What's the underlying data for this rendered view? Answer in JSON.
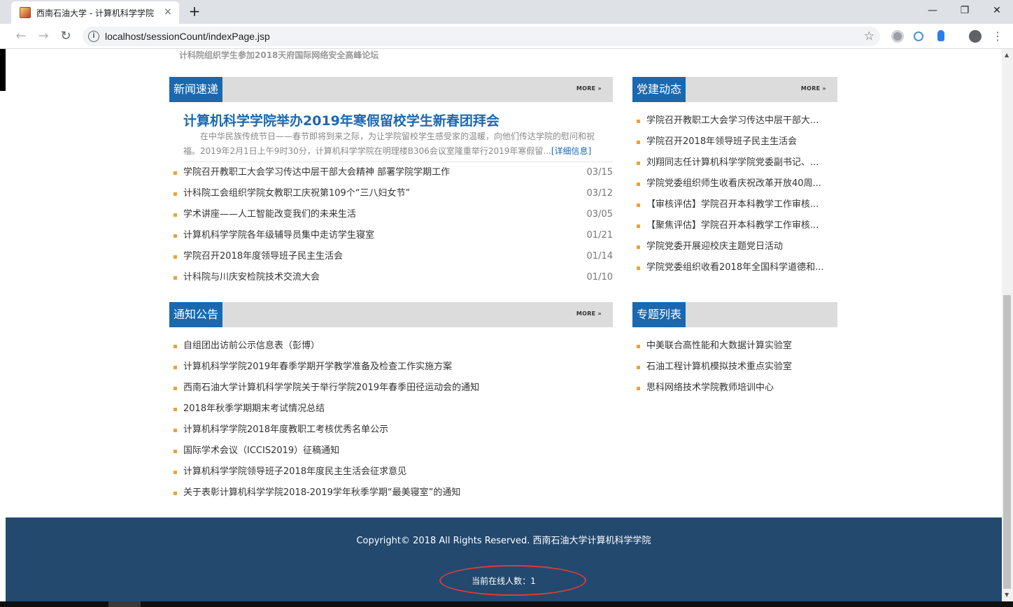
{
  "browser": {
    "tab_title": "西南石油大学 - 计算机科学学院",
    "url": "localhost/sessionCount/indexPage.jsp",
    "icons": {
      "tab_close": "×",
      "new_tab": "+",
      "minimize": "—",
      "restore": "❐",
      "close": "✕",
      "back": "←",
      "forward": "→",
      "reload": "↻",
      "info": "i",
      "star": "☆",
      "menu": "⋮"
    }
  },
  "page": {
    "top_news": "计科院组织学生参加2018天府国际网络安全高峰论坛",
    "news": {
      "title": "新闻速递",
      "more": "MORE »",
      "headline": "计算机科学学院举办2019年寒假留校学生新春团拜会",
      "summary": "在中华民族传统节日——春节即将到来之际，为让学院留校学生感受家的温暖，向他们传达学院的慰问和祝福。2019年2月1日上午9时30分，计算机科学学院在明理楼B306会议室隆重举行2019年寒假留...",
      "detail_link": "[详细信息]",
      "items": [
        {
          "text": "学院召开教职工大会学习传达中层干部大会精神 部署学院学期工作",
          "date": "03/15"
        },
        {
          "text": "计科院工会组织学院女教职工庆祝第109个“三八妇女节”",
          "date": "03/12"
        },
        {
          "text": "学术讲座——人工智能改变我们的未来生活",
          "date": "03/05"
        },
        {
          "text": "计算机科学学院各年级辅导员集中走访学生寝室",
          "date": "01/21"
        },
        {
          "text": "学院召开2018年度领导班子民主生活会",
          "date": "01/14"
        },
        {
          "text": "计科院与川庆安检院技术交流大会",
          "date": "01/10"
        }
      ]
    },
    "party": {
      "title": "党建动态",
      "more": "MORE »",
      "items": [
        "学院召开教职工大会学习传达中层干部大...",
        "学院召开2018年领导班子民主生活会",
        "刘翔同志任计算机科学学院党委副书记、...",
        "学院党委组织师生收看庆祝改革开放40周...",
        "【审核评估】学院召开本科教学工作审核...",
        "【聚焦评估】学院召开本科教学工作审核...",
        "学院党委开展迎校庆主题党日活动",
        "学院党委组织收看2018年全国科学道德和..."
      ]
    },
    "notice": {
      "title": "通知公告",
      "more": "MORE »",
      "items": [
        "自组团出访前公示信息表（彭博）",
        "计算机科学学院2019年春季学期开学教学准备及检查工作实施方案",
        "西南石油大学计算机科学学院关于举行学院2019年春季田径运动会的通知",
        "2018年秋季学期期末考试情况总结",
        "计算机科学学院2018年度教职工考核优秀名单公示",
        "国际学术会议（ICCIS2019）征稿通知",
        "计算机科学学院领导班子2018年度民主生活会征求意见",
        "关于表彰计算机科学学院2018-2019学年秋季学期“最美寝室”的通知"
      ]
    },
    "topics": {
      "title": "专题列表",
      "items": [
        "中美联合高性能和大数据计算实验室",
        "石油工程计算机模拟技术重点实验室",
        "思科网络技术学院教师培训中心"
      ]
    },
    "footer": {
      "copyright": "Copyright© 2018 All Rights Reserved. 西南石油大学计算机科学学院",
      "online_count": "当前在线人数：1"
    }
  },
  "colors": {
    "accent": "#1a68b0",
    "footer_bg": "#23496f",
    "bullet": "#e8a33a",
    "highlight_ellipse": "#e03a3a"
  }
}
